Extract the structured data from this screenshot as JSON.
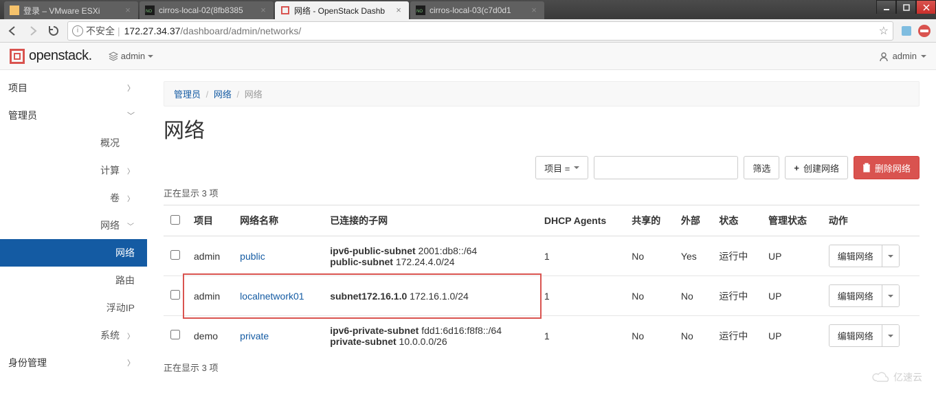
{
  "browser": {
    "tabs": [
      {
        "title": "登录 – VMware ESXi",
        "favicon": "vmware"
      },
      {
        "title": "cirros-local-02(8fb8385",
        "favicon": "vnc"
      },
      {
        "title": "网络 - OpenStack Dashb",
        "favicon": "openstack",
        "active": true
      },
      {
        "title": "cirros-local-03(c7d0d1",
        "favicon": "vnc"
      }
    ],
    "insecure_label": "不安全",
    "url_host": "172.27.34.37",
    "url_path": "/dashboard/admin/networks/"
  },
  "topbar": {
    "brand": "openstack.",
    "project_dd": "admin",
    "user_dd": "admin"
  },
  "sidebar": {
    "project_label": "项目",
    "admin_label": "管理员",
    "overview_label": "概况",
    "compute_label": "计算",
    "volumes_label": "卷",
    "network_label": "网络",
    "network_children": {
      "networks": "网络",
      "routers": "路由",
      "floating_ips": "浮动IP"
    },
    "system_label": "系统",
    "identity_label": "身份管理"
  },
  "breadcrumb": {
    "item1": "管理员",
    "item2": "网络",
    "current": "网络"
  },
  "page_title": "网络",
  "toolbar": {
    "filter_dd": "项目 =",
    "filter_btn": "筛选",
    "create_btn": "创建网络",
    "delete_btn": "删除网络"
  },
  "count_text": "正在显示 3 项",
  "table": {
    "headers": {
      "project": "项目",
      "name": "网络名称",
      "subnets": "已连接的子网",
      "dhcp": "DHCP Agents",
      "shared": "共享的",
      "external": "外部",
      "status": "状态",
      "admin_state": "管理状态",
      "actions": "动作"
    },
    "action_label": "编辑网络",
    "rows": [
      {
        "project": "admin",
        "name": "public",
        "subnets": [
          {
            "name": "ipv6-public-subnet",
            "cidr": "2001:db8::/64"
          },
          {
            "name": "public-subnet",
            "cidr": "172.24.4.0/24"
          }
        ],
        "dhcp": "1",
        "shared": "No",
        "external": "Yes",
        "status": "运行中",
        "admin_state": "UP",
        "highlight": false
      },
      {
        "project": "admin",
        "name": "localnetwork01",
        "subnets": [
          {
            "name": "subnet172.16.1.0",
            "cidr": "172.16.1.0/24"
          }
        ],
        "dhcp": "1",
        "shared": "No",
        "external": "No",
        "status": "运行中",
        "admin_state": "UP",
        "highlight": true
      },
      {
        "project": "demo",
        "name": "private",
        "subnets": [
          {
            "name": "ipv6-private-subnet",
            "cidr": "fdd1:6d16:f8f8::/64"
          },
          {
            "name": "private-subnet",
            "cidr": "10.0.0.0/26"
          }
        ],
        "dhcp": "1",
        "shared": "No",
        "external": "No",
        "status": "运行中",
        "admin_state": "UP",
        "highlight": false
      }
    ]
  },
  "watermark_text": "亿速云"
}
